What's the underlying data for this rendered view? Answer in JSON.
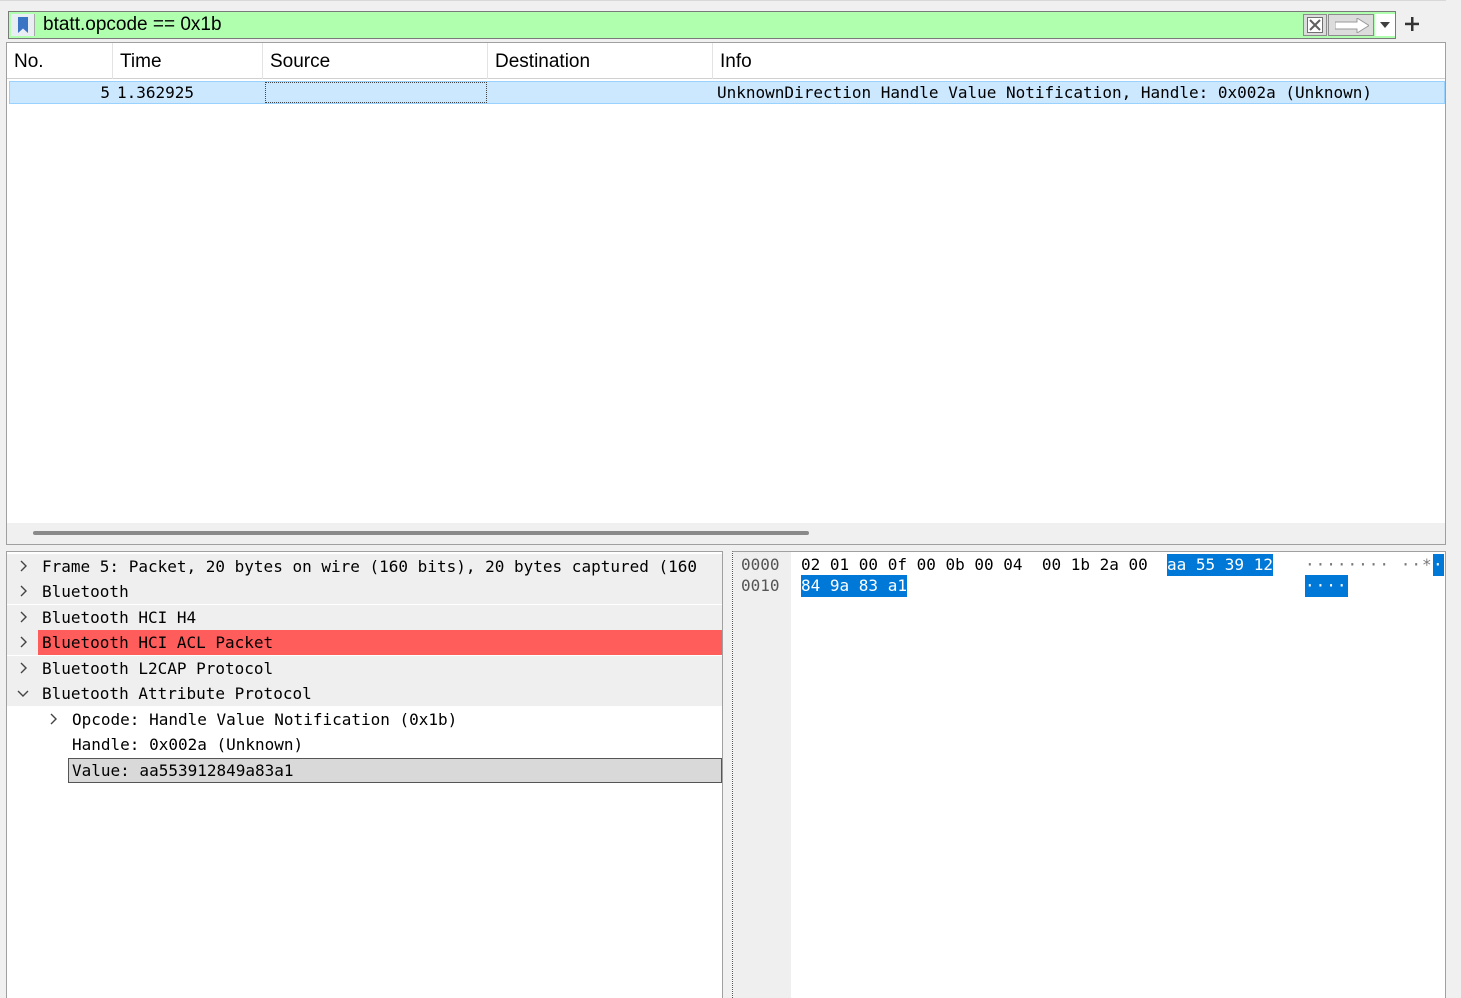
{
  "filter": {
    "text": "btatt.opcode == 0x1b",
    "bg_color": "#afffaf"
  },
  "icons": {
    "bookmark": "bookmark-icon",
    "clear": "clear-x-icon",
    "apply": "arrow-right-icon",
    "dropdown": "chevron-down-icon",
    "add": "plus-icon"
  },
  "packet_list": {
    "columns": [
      "No.",
      "Time",
      "Source",
      "Destination",
      "Info"
    ],
    "rows": [
      {
        "no": "5",
        "time": "1.362925",
        "source": "",
        "destination": "",
        "info": "UnknownDirection Handle Value Notification, Handle: 0x002a (Unknown)"
      }
    ]
  },
  "details": {
    "items": [
      {
        "label": "Frame 5: Packet, 20 bytes on wire (160 bits), 20 bytes captured (160",
        "expanded": false
      },
      {
        "label": "Bluetooth",
        "expanded": false
      },
      {
        "label": "Bluetooth HCI H4",
        "expanded": false
      },
      {
        "label": "Bluetooth HCI ACL Packet",
        "expanded": false,
        "highlight": "#ff5c5c"
      },
      {
        "label": "Bluetooth L2CAP Protocol",
        "expanded": false
      },
      {
        "label": "Bluetooth Attribute Protocol",
        "expanded": true
      },
      {
        "label": "Opcode: Handle Value Notification (0x1b)",
        "expanded": false
      },
      {
        "label": "Handle: 0x002a (Unknown)"
      },
      {
        "label": "Value: aa553912849a83a1",
        "selected": true
      }
    ]
  },
  "bytes": {
    "rows": [
      {
        "offset": "0000",
        "hex_plain": "02 01 00 0f 00 0b 00 04  00 1b 2a 00",
        "hex_selected": "aa 55 39 12",
        "ascii_plain": "········ ··*·",
        "ascii_selected": "·"
      },
      {
        "offset": "0010",
        "hex_plain": "",
        "hex_selected": "84 9a 83 a1",
        "ascii_plain": "",
        "ascii_selected": "····"
      }
    ],
    "selection_color": "#0078d7"
  }
}
